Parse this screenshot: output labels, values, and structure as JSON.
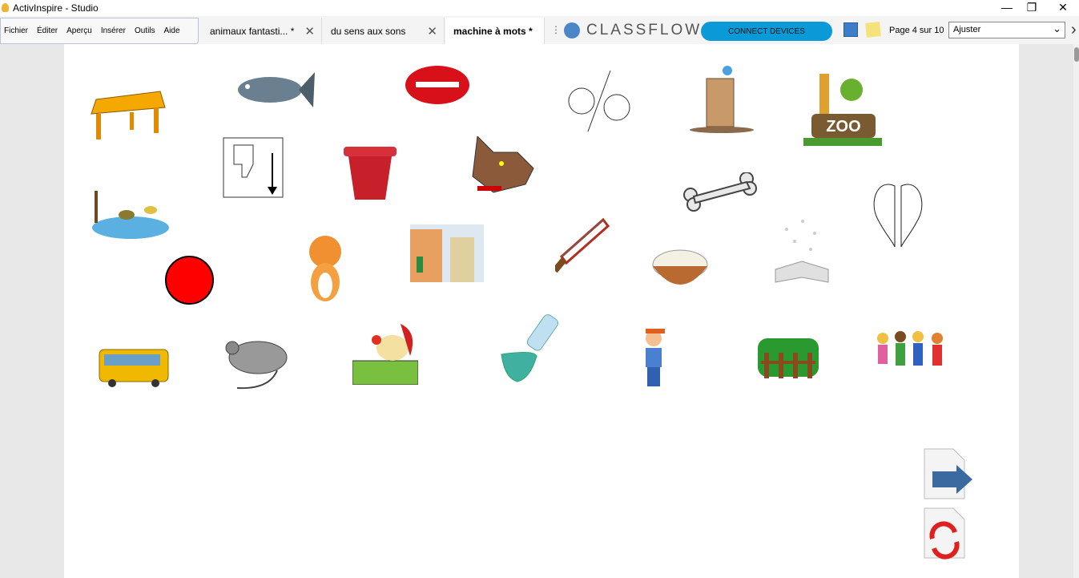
{
  "window": {
    "title": "ActivInspire - Studio",
    "minimize": "—",
    "restore": "❐",
    "close": "✕"
  },
  "menu": [
    "Fichier",
    "Éditer",
    "Aperçu",
    "Insérer",
    "Outils",
    "Aide"
  ],
  "tabs": [
    {
      "label": "animaux fantasti... *",
      "close": "✕"
    },
    {
      "label": "du sens aux sons",
      "close": "✕"
    },
    {
      "label": "machine à mots *",
      "active": true
    }
  ],
  "tab_more": "⋮",
  "classflow": {
    "logo": "CLASSFLOW",
    "connect": "CONNECT DEVICES",
    "accent": "#0a9ad8"
  },
  "page": {
    "indicator": "Page 4 sur 10",
    "zoom": "Ajuster",
    "next": "›"
  },
  "images": [
    "table",
    "fish",
    "lips",
    "faces",
    "tree-stump",
    "zoo",
    "thumb-down-card",
    "flower-pot",
    "wolf",
    "bone",
    "wings",
    "pond-ducks",
    "cat",
    "street",
    "saw",
    "rice-bowl",
    "book",
    "red-circle",
    "bus",
    "rat",
    "rooster",
    "bottle-pouring",
    "boy",
    "fence-hedge",
    "children"
  ],
  "nav": {
    "next_page": "next-page-icon",
    "reset": "reset-page-icon"
  }
}
